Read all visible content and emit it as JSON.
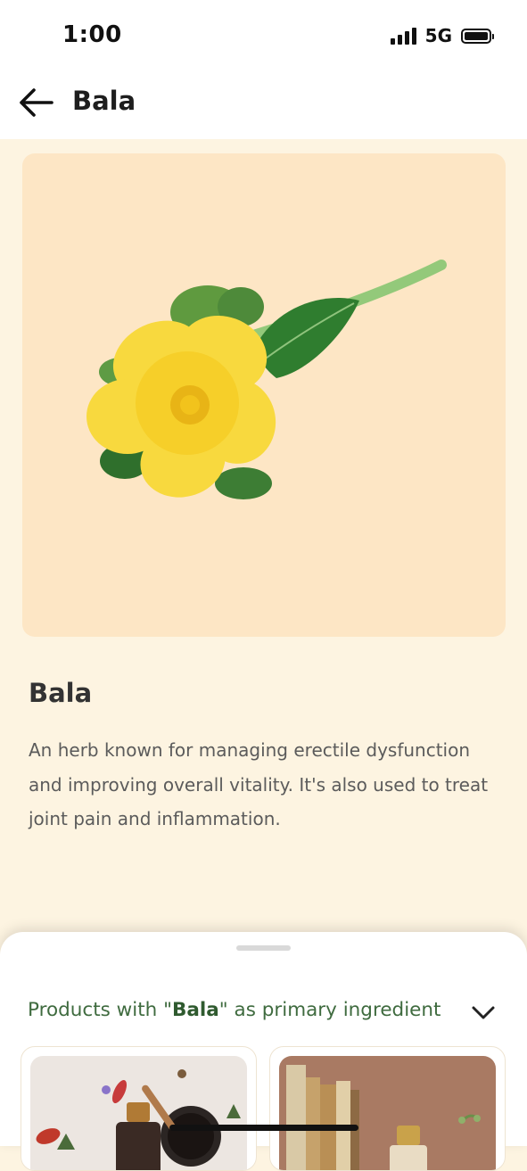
{
  "status_bar": {
    "time": "1:00",
    "network": "5G"
  },
  "header": {
    "title": "Bala",
    "back_icon": "arrow-left-icon"
  },
  "hero": {
    "image": "bala-flower-image"
  },
  "herb": {
    "name": "Bala",
    "description": "An herb known for managing erectile dysfunction and improving overall vitality. It's also used to treat joint pain and inflammation."
  },
  "sheet": {
    "title_prefix": "Products with \"",
    "title_highlight": "Bala",
    "title_suffix": "\" as primary ingredient",
    "toggle_icon": "chevron-down-icon"
  },
  "products": [
    {
      "image": "herbal-oil-product-image"
    },
    {
      "image": "bottle-product-image"
    }
  ],
  "colors": {
    "accent_green": "#3f6b3f",
    "page_bg": "#fdf4e1",
    "hero_bg": "#fde6c5"
  }
}
